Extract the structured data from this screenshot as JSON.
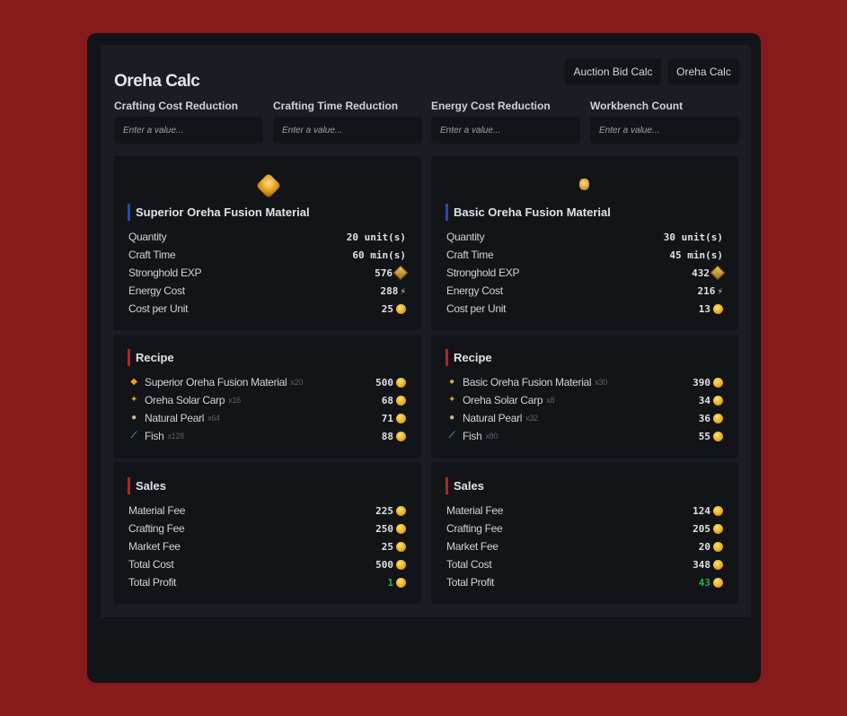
{
  "header": {
    "title": "Oreha Calc"
  },
  "nav": {
    "auction_label": "Auction Bid Calc",
    "oreha_label": "Oreha Calc"
  },
  "fields": [
    {
      "label": "Crafting Cost Reduction",
      "placeholder": "Enter a value..."
    },
    {
      "label": "Crafting Time Reduction",
      "placeholder": "Enter a value..."
    },
    {
      "label": "Energy Cost Reduction",
      "placeholder": "Enter a value..."
    },
    {
      "label": "Workbench Count",
      "placeholder": "Enter a value..."
    }
  ],
  "materials": [
    {
      "name": "Superior Oreha Fusion Material",
      "stats": [
        {
          "label": "Quantity",
          "value": "20 unit(s)"
        },
        {
          "label": "Craft Time",
          "value": "60 min(s)"
        },
        {
          "label": "Stronghold EXP",
          "value": "576"
        },
        {
          "label": "Energy Cost",
          "value": "288"
        },
        {
          "label": "Cost per Unit",
          "value": "25"
        }
      ],
      "recipe_title": "Recipe",
      "recipe": [
        {
          "name": "Superior Oreha Fusion Material",
          "qty": "x20",
          "price": "500"
        },
        {
          "name": "Oreha Solar Carp",
          "qty": "x16",
          "price": "68"
        },
        {
          "name": "Natural Pearl",
          "qty": "x64",
          "price": "71"
        },
        {
          "name": "Fish",
          "qty": "x128",
          "price": "88"
        }
      ],
      "sales_title": "Sales",
      "sales": [
        {
          "label": "Material Fee",
          "value": "225"
        },
        {
          "label": "Crafting Fee",
          "value": "250"
        },
        {
          "label": "Market Fee",
          "value": "25"
        },
        {
          "label": "Total Cost",
          "value": "500"
        },
        {
          "label": "Total Profit",
          "value": "1"
        }
      ]
    },
    {
      "name": "Basic Oreha Fusion Material",
      "stats": [
        {
          "label": "Quantity",
          "value": "30 unit(s)"
        },
        {
          "label": "Craft Time",
          "value": "45 min(s)"
        },
        {
          "label": "Stronghold EXP",
          "value": "432"
        },
        {
          "label": "Energy Cost",
          "value": "216"
        },
        {
          "label": "Cost per Unit",
          "value": "13"
        }
      ],
      "recipe_title": "Recipe",
      "recipe": [
        {
          "name": "Basic Oreha Fusion Material",
          "qty": "x30",
          "price": "390"
        },
        {
          "name": "Oreha Solar Carp",
          "qty": "x8",
          "price": "34"
        },
        {
          "name": "Natural Pearl",
          "qty": "x32",
          "price": "36"
        },
        {
          "name": "Fish",
          "qty": "x80",
          "price": "55"
        }
      ],
      "sales_title": "Sales",
      "sales": [
        {
          "label": "Material Fee",
          "value": "124"
        },
        {
          "label": "Crafting Fee",
          "value": "205"
        },
        {
          "label": "Market Fee",
          "value": "20"
        },
        {
          "label": "Total Cost",
          "value": "348"
        },
        {
          "label": "Total Profit",
          "value": "43"
        }
      ]
    }
  ],
  "colors": {
    "profit": "#2eb14b",
    "accent_blue": "#2549b5",
    "accent_red": "#b3261e",
    "background": "#851b1b"
  }
}
